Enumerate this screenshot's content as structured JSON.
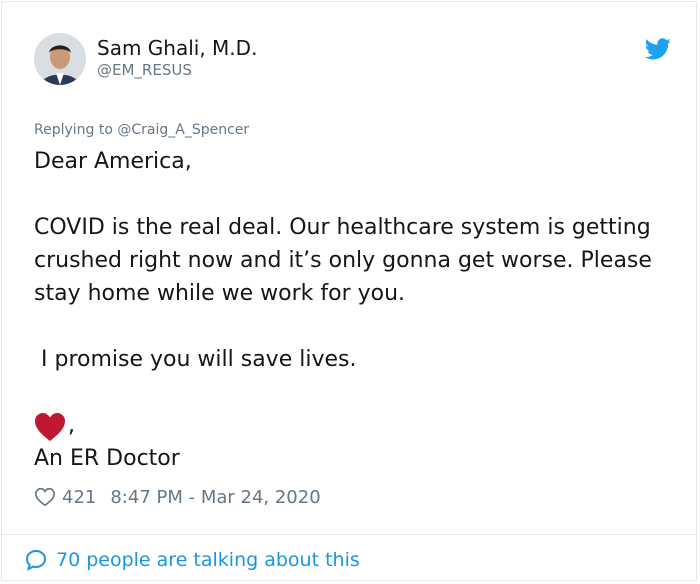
{
  "tweet": {
    "author_name": "Sam Ghali, M.D.",
    "author_handle": "@EM_RESUS",
    "reply_prefix": "Replying to",
    "reply_to": "@Craig_A_Spencer",
    "line1": "Dear America,",
    "line2": "COVID is the real deal. Our healthcare system is getting crushed right now and it’s only gonna get worse. Please stay home while we work for you.",
    "line3": " I promise you will save lives.",
    "heart_comma": ",",
    "signature": "An ER Doctor",
    "like_count": "421",
    "timestamp": "8:47 PM - Mar 24, 2020",
    "conversation": "70 people are talking about this"
  },
  "icons": {
    "brand": "twitter-bird-icon",
    "emoji": "red-heart-icon",
    "like": "heart-outline-icon",
    "reply": "speech-bubble-icon"
  },
  "colors": {
    "twitter_blue": "#1da1f2",
    "link_blue": "#1b95e0",
    "muted_gray": "#657786",
    "heart_red": "#be1931"
  }
}
